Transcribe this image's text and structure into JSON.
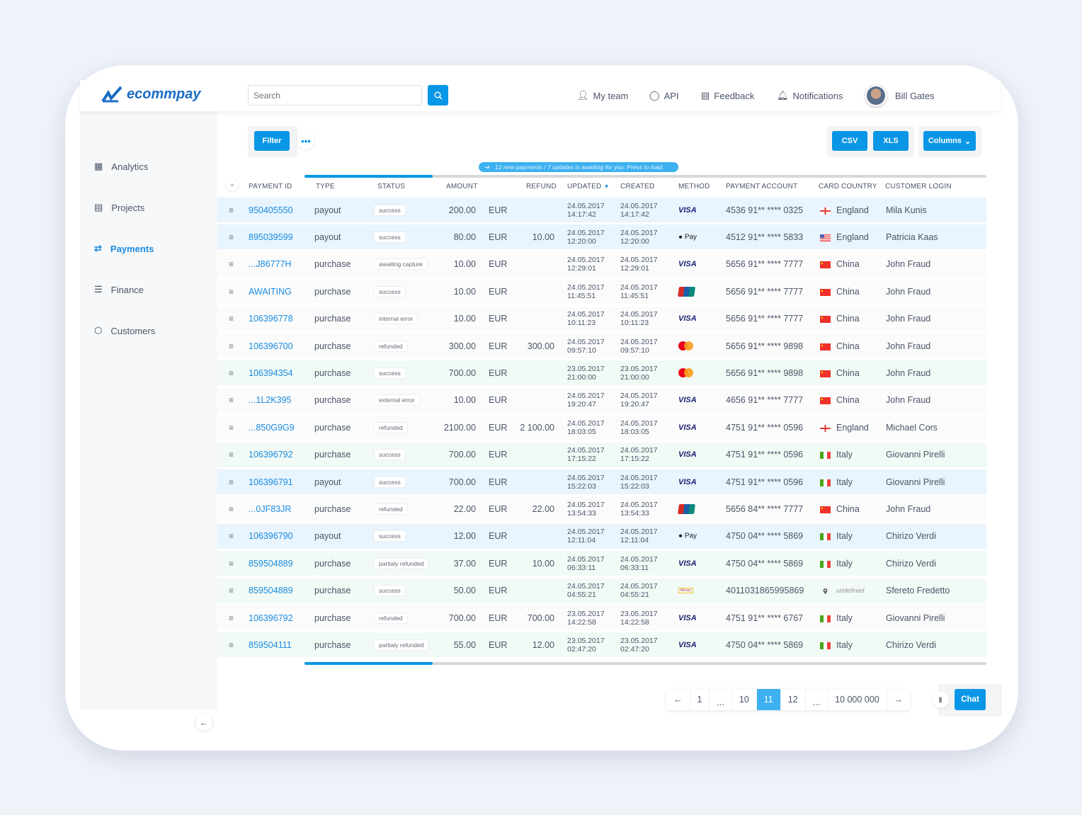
{
  "header": {
    "brand": "ecommpay",
    "search_placeholder": "Search",
    "nav": [
      "My team",
      "API",
      "Feedback",
      "Notifications"
    ],
    "user": "Bill Gates"
  },
  "sidebar": {
    "items": [
      "Analytics",
      "Projects",
      "Payments",
      "Finance",
      "Customers"
    ],
    "active": "Payments"
  },
  "toolbar": {
    "filter": "Filter",
    "csv": "CSV",
    "xls": "XLS",
    "columns": "Columns"
  },
  "notice": "12 new payments / 7 updates is awaiting for you. Press to load.",
  "table": {
    "columns": [
      "PAYMENT ID",
      "TYPE",
      "STATUS",
      "AMOUNT",
      "REFUND",
      "UPDATED",
      "CREATED",
      "METHOD",
      "PAYMENT ACCOUNT",
      "CARD COUNTRY",
      "CUSTOMER LOGIN"
    ],
    "sort_indicator": "▼",
    "rows": [
      {
        "id": "950405550",
        "type": "payout",
        "status": "success",
        "amount": "200.00",
        "currency": "EUR",
        "refund": "",
        "updated": [
          "24.05.2017",
          "14:17:42"
        ],
        "created": [
          "24.05.2017",
          "14:17:42"
        ],
        "method": "visa",
        "account": "4536 91** **** 0325",
        "flag": "england",
        "country": "England",
        "login": "Mila Kunis",
        "tone": "blue"
      },
      {
        "id": "895039599",
        "type": "payout",
        "status": "success",
        "amount": "80.00",
        "currency": "EUR",
        "refund": "10.00",
        "updated": [
          "24.05.2017",
          "12:20:00"
        ],
        "created": [
          "24.05.2017",
          "12:20:00"
        ],
        "method": "applepay",
        "account": "4512 91** **** 5833",
        "flag": "us",
        "country": "England",
        "login": "Patricia Kaas",
        "tone": "blue"
      },
      {
        "id": "...J86777H",
        "type": "purchase",
        "status": "awaiting capture",
        "amount": "10.00",
        "currency": "EUR",
        "refund": "",
        "updated": [
          "24.05.2017",
          "12:29:01"
        ],
        "created": [
          "24.05.2017",
          "12:29:01"
        ],
        "method": "visa",
        "account": "5656 91** **** 7777",
        "flag": "china",
        "country": "China",
        "login": "John Fraud",
        "tone": "white"
      },
      {
        "id": "AWAITING",
        "type": "purchase",
        "status": "success",
        "amount": "10.00",
        "currency": "EUR",
        "refund": "",
        "updated": [
          "24.05.2017",
          "11:45:51"
        ],
        "created": [
          "24.05.2017",
          "11:45:51"
        ],
        "method": "unionpay",
        "account": "5656 91** **** 7777",
        "flag": "china",
        "country": "China",
        "login": "John Fraud",
        "tone": "white"
      },
      {
        "id": "106396778",
        "type": "purchase",
        "status": "internal error",
        "amount": "10.00",
        "currency": "EUR",
        "refund": "",
        "updated": [
          "24.05.2017",
          "10:11:23"
        ],
        "created": [
          "24.05.2017",
          "10:11:23"
        ],
        "method": "visa",
        "account": "5656 91** **** 7777",
        "flag": "china",
        "country": "China",
        "login": "John Fraud",
        "tone": "white"
      },
      {
        "id": "106396700",
        "type": "purchase",
        "status": "refunded",
        "amount": "300.00",
        "currency": "EUR",
        "refund": "300.00",
        "updated": [
          "24.05.2017",
          "09:57:10"
        ],
        "created": [
          "24.05.2017",
          "09:57:10"
        ],
        "method": "mastercard",
        "account": "5656 91** **** 9898",
        "flag": "china",
        "country": "China",
        "login": "John Fraud",
        "tone": "white"
      },
      {
        "id": "106394354",
        "type": "purchase",
        "status": "success",
        "amount": "700.00",
        "currency": "EUR",
        "refund": "",
        "updated": [
          "23.05.2017",
          "21:00:00"
        ],
        "created": [
          "23.05.2017",
          "21:00:00"
        ],
        "method": "mastercard",
        "account": "5656 91** **** 9898",
        "flag": "china",
        "country": "China",
        "login": "John Fraud",
        "tone": "green"
      },
      {
        "id": "...1L2K395",
        "type": "purchase",
        "status": "external error",
        "amount": "10.00",
        "currency": "EUR",
        "refund": "",
        "updated": [
          "24.05.2017",
          "19:20:47"
        ],
        "created": [
          "24.05.2017",
          "19:20:47"
        ],
        "method": "visa",
        "account": "4656 91** **** 7777",
        "flag": "china",
        "country": "China",
        "login": "John Fraud",
        "tone": "white"
      },
      {
        "id": "...850G9G9",
        "type": "purchase",
        "status": "refunded",
        "amount": "2100.00",
        "currency": "EUR",
        "refund": "2 100.00",
        "updated": [
          "24.05.2017",
          "18:03:05"
        ],
        "created": [
          "24.05.2017",
          "18:03:05"
        ],
        "method": "visa",
        "account": "4751 91** **** 0596",
        "flag": "england",
        "country": "England",
        "login": "Michael Cors",
        "tone": "white"
      },
      {
        "id": "106396792",
        "type": "purchase",
        "status": "success",
        "amount": "700.00",
        "currency": "EUR",
        "refund": "",
        "updated": [
          "24.05.2017",
          "17:15:22"
        ],
        "created": [
          "24.05.2017",
          "17:15:22"
        ],
        "method": "visa",
        "account": "4751 91** **** 0596",
        "flag": "italy",
        "country": "Italy",
        "login": "Giovanni Pirelli",
        "tone": "green"
      },
      {
        "id": "106396791",
        "type": "payout",
        "status": "success",
        "amount": "700.00",
        "currency": "EUR",
        "refund": "",
        "updated": [
          "24.05.2017",
          "15:22:03"
        ],
        "created": [
          "24.05.2017",
          "15:22:03"
        ],
        "method": "visa",
        "account": "4751 91** **** 0596",
        "flag": "italy",
        "country": "Italy",
        "login": "Giovanni Pirelli",
        "tone": "blue"
      },
      {
        "id": "...0JF83JR",
        "type": "purchase",
        "status": "refunded",
        "amount": "22.00",
        "currency": "EUR",
        "refund": "22.00",
        "updated": [
          "24.05.2017",
          "13:54:33"
        ],
        "created": [
          "24.05.2017",
          "13:54:33"
        ],
        "method": "unionpay",
        "account": "5656 84** **** 7777",
        "flag": "china",
        "country": "China",
        "login": "John Fraud",
        "tone": "white"
      },
      {
        "id": "106396790",
        "type": "payout",
        "status": "success",
        "amount": "12.00",
        "currency": "EUR",
        "refund": "",
        "updated": [
          "24.05.2017",
          "12:11:04"
        ],
        "created": [
          "24.05.2017",
          "12:11:04"
        ],
        "method": "applepay",
        "account": "4750 04** **** 5869",
        "flag": "italy",
        "country": "Italy",
        "login": "Chirizo Verdi",
        "tone": "blue"
      },
      {
        "id": "859504889",
        "type": "purchase",
        "status": "partialy refunded",
        "amount": "37.00",
        "currency": "EUR",
        "refund": "10.00",
        "updated": [
          "24.05.2017",
          "06:33:11"
        ],
        "created": [
          "24.05.2017",
          "06:33:11"
        ],
        "method": "visa",
        "account": "4750 04** **** 5869",
        "flag": "italy",
        "country": "Italy",
        "login": "Chirizo Verdi",
        "tone": "green"
      },
      {
        "id": "859504889",
        "type": "purchase",
        "status": "success",
        "amount": "50.00",
        "currency": "EUR",
        "refund": "",
        "updated": [
          "24.05.2017",
          "04:55:21"
        ],
        "created": [
          "24.05.2017",
          "04:55:21"
        ],
        "method": "yandexmoney",
        "account": "4011031865995869",
        "flag": "pin",
        "country": "undefined",
        "login": "Sfereto Fredetto",
        "tone": "green"
      },
      {
        "id": "106396792",
        "type": "purchase",
        "status": "refunded",
        "amount": "700.00",
        "currency": "EUR",
        "refund": "700.00",
        "updated": [
          "23.05.2017",
          "14:22:58"
        ],
        "created": [
          "23.05.2017",
          "14:22:58"
        ],
        "method": "visa",
        "account": "4751 91** **** 6767",
        "flag": "italy",
        "country": "Italy",
        "login": "Giovanni Pirelli",
        "tone": "white"
      },
      {
        "id": "859504111",
        "type": "purchase",
        "status": "partialy refunded",
        "amount": "55.00",
        "currency": "EUR",
        "refund": "12.00",
        "updated": [
          "23.05.2017",
          "02:47:20"
        ],
        "created": [
          "23.05.2017",
          "02:47:20"
        ],
        "method": "visa",
        "account": "4750 04** **** 5869",
        "flag": "italy",
        "country": "Italy",
        "login": "Chirizo Verdi",
        "tone": "green"
      }
    ],
    "method_labels": {
      "visa": "VISA",
      "applepay": "Pay",
      "yandexmoney": "Money"
    }
  },
  "pagination": {
    "prev": "←",
    "pages": [
      "1",
      "...",
      "10",
      "11",
      "12",
      "...",
      "10 000 000"
    ],
    "current": "11",
    "next": "→"
  },
  "chat": {
    "label": "Chat"
  },
  "colors": {
    "accent": "#0a96e6",
    "link": "#1a8be0",
    "row_blue": "#e8f4fe",
    "row_green": "#f1faf5"
  }
}
